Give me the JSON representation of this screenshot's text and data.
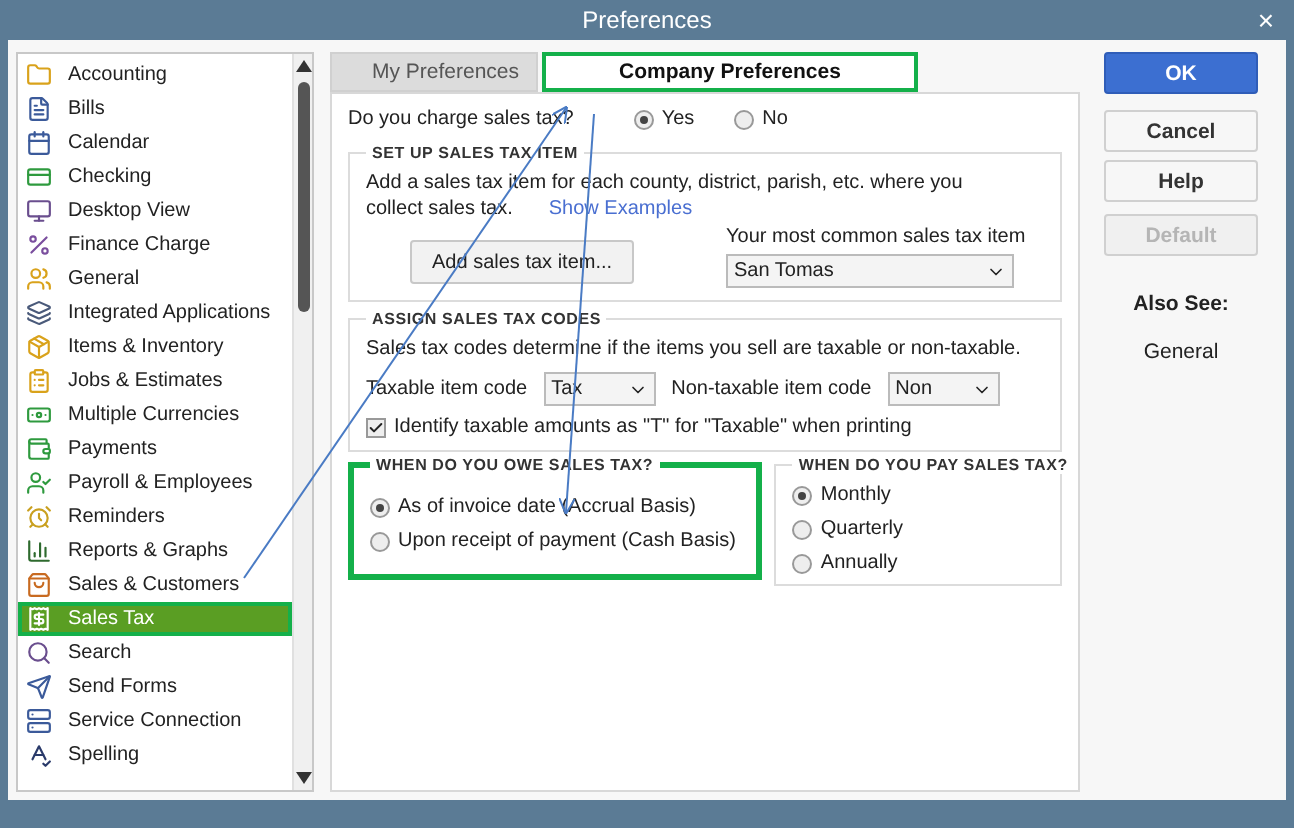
{
  "window": {
    "title": "Preferences",
    "close": "×"
  },
  "sidebar": {
    "items": [
      {
        "label": "Accounting",
        "selected": false
      },
      {
        "label": "Bills",
        "selected": false
      },
      {
        "label": "Calendar",
        "selected": false
      },
      {
        "label": "Checking",
        "selected": false
      },
      {
        "label": "Desktop View",
        "selected": false
      },
      {
        "label": "Finance Charge",
        "selected": false
      },
      {
        "label": "General",
        "selected": false
      },
      {
        "label": "Integrated Applications",
        "selected": false
      },
      {
        "label": "Items & Inventory",
        "selected": false
      },
      {
        "label": "Jobs & Estimates",
        "selected": false
      },
      {
        "label": "Multiple Currencies",
        "selected": false
      },
      {
        "label": "Payments",
        "selected": false
      },
      {
        "label": "Payroll & Employees",
        "selected": false
      },
      {
        "label": "Reminders",
        "selected": false
      },
      {
        "label": "Reports & Graphs",
        "selected": false
      },
      {
        "label": "Sales & Customers",
        "selected": false
      },
      {
        "label": "Sales Tax",
        "selected": true,
        "highlighted": true
      },
      {
        "label": "Search",
        "selected": false
      },
      {
        "label": "Send Forms",
        "selected": false
      },
      {
        "label": "Service Connection",
        "selected": false
      },
      {
        "label": "Spelling",
        "selected": false
      }
    ]
  },
  "tabs": [
    {
      "label": "My Preferences",
      "selected": false,
      "highlighted": false
    },
    {
      "label": "Company Preferences",
      "selected": true,
      "highlighted": true
    }
  ],
  "charge_question": {
    "label": "Do you charge sales tax?",
    "options": [
      {
        "label": "Yes",
        "selected": true
      },
      {
        "label": "No",
        "selected": false
      }
    ]
  },
  "setup_section": {
    "title": "SET UP SALES TAX ITEM",
    "text": "Add a sales tax item for each county, district, parish, etc. where you collect sales tax.",
    "link": "Show Examples",
    "button": "Add sales tax item...",
    "common_label": "Your most common sales tax item",
    "common_value": "San Tomas"
  },
  "assign_section": {
    "title": "ASSIGN SALES TAX CODES",
    "text": "Sales tax codes determine if the items you sell are taxable or non-taxable.",
    "taxable_label": "Taxable item code",
    "taxable_value": "Tax",
    "nontaxable_label": "Non-taxable item code",
    "nontaxable_value": "Non",
    "identify": {
      "label": "Identify taxable amounts as \"T\" for \"Taxable\" when printing",
      "checked": true
    }
  },
  "owe_section": {
    "title": "WHEN DO YOU OWE SALES TAX?",
    "highlighted": true,
    "options": [
      {
        "label": "As of invoice date (Accrual Basis)",
        "selected": true
      },
      {
        "label": "Upon receipt of payment (Cash Basis)",
        "selected": false
      }
    ]
  },
  "pay_section": {
    "title": "WHEN DO YOU PAY SALES TAX?",
    "highlighted": false,
    "options": [
      {
        "label": "Monthly",
        "selected": true
      },
      {
        "label": "Quarterly",
        "selected": false
      },
      {
        "label": "Annually",
        "selected": false
      }
    ]
  },
  "buttons": [
    {
      "label": "OK",
      "kind": "primary"
    },
    {
      "label": "Cancel",
      "kind": "normal"
    },
    {
      "label": "Help",
      "kind": "normal"
    },
    {
      "label": "Default",
      "kind": "disabled"
    }
  ],
  "also_see": {
    "title": "Also See:",
    "links": [
      "General"
    ]
  }
}
